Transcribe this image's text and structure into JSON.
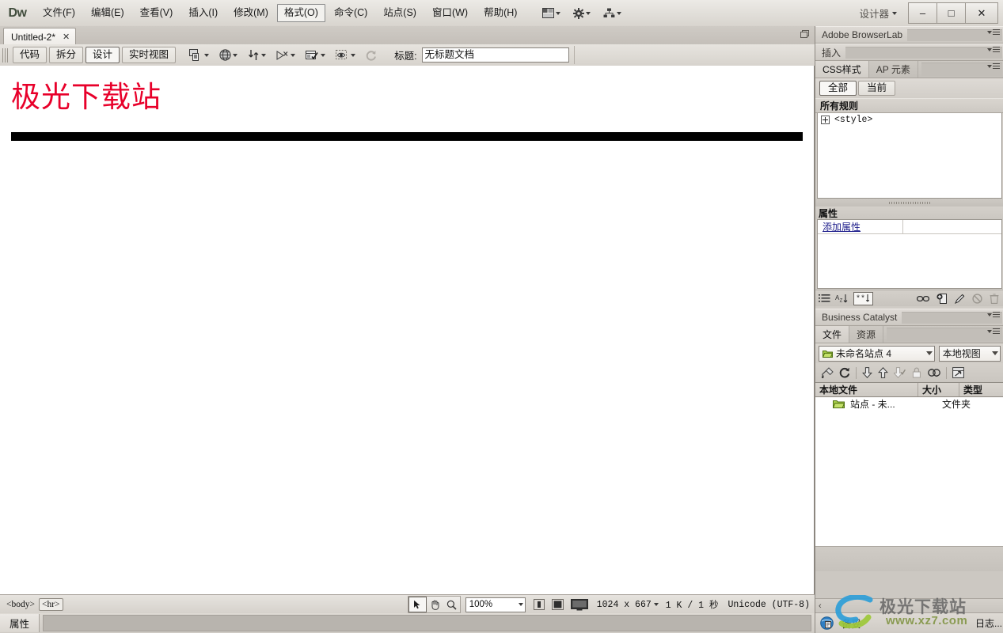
{
  "app": {
    "logo": "Dw",
    "workspace_label": "设计器"
  },
  "menubar": {
    "items": [
      {
        "label": "文件(F)",
        "active": false
      },
      {
        "label": "编辑(E)",
        "active": false
      },
      {
        "label": "查看(V)",
        "active": false
      },
      {
        "label": "插入(I)",
        "active": false
      },
      {
        "label": "修改(M)",
        "active": false
      },
      {
        "label": "格式(O)",
        "active": true
      },
      {
        "label": "命令(C)",
        "active": false
      },
      {
        "label": "站点(S)",
        "active": false
      },
      {
        "label": "窗口(W)",
        "active": false
      },
      {
        "label": "帮助(H)",
        "active": false
      }
    ],
    "quick_icons": [
      "layout-icon",
      "gear-icon",
      "site-icon"
    ]
  },
  "window_controls": {
    "minimize": "–",
    "maximize": "□",
    "close": "✕"
  },
  "document_tab": {
    "title": "Untitled-2*",
    "close": "✕"
  },
  "doc_toolbar": {
    "view_buttons": [
      {
        "label": "代码",
        "selected": false
      },
      {
        "label": "拆分",
        "selected": false
      },
      {
        "label": "设计",
        "selected": true
      },
      {
        "label": "实时视图",
        "selected": false
      }
    ],
    "icons": [
      "multiscreen-preview-icon",
      "preview-in-browser-icon",
      "file-management-icon",
      "validate-markup-icon",
      "visual-aids-icon",
      "live-code-inspect-icon",
      "refresh-icon"
    ],
    "title_label": "标题:",
    "title_value": "无标题文档",
    "title_placeholder": "无标题文档"
  },
  "canvas": {
    "heading": "极光下载站",
    "heading_color": "#e8002a",
    "hr": "horizontal-rule"
  },
  "status_bar": {
    "tag_selector": [
      {
        "tag": "<body>",
        "selected": false
      },
      {
        "tag": "<hr>",
        "selected": true
      }
    ],
    "tools": [
      {
        "name": "select-tool",
        "selected": true
      },
      {
        "name": "hand-tool",
        "selected": false
      },
      {
        "name": "zoom-tool",
        "selected": false
      }
    ],
    "zoom_value": "100%",
    "window_sizes": [
      "phone-size-icon",
      "tablet-size-icon",
      "desktop-size-icon"
    ],
    "dimensions": "1024 x 667",
    "download_info": "1 K / 1 秒",
    "encoding": "Unicode (UTF-8)"
  },
  "properties_bar": {
    "tab_label": "属性"
  },
  "dock": {
    "browserlab": {
      "title": "Adobe BrowserLab"
    },
    "insert": {
      "title": "插入"
    },
    "css_panel": {
      "tabs": [
        {
          "label": "CSS样式",
          "selected": true
        },
        {
          "label": "AP 元素",
          "selected": false
        }
      ],
      "mode_buttons": [
        {
          "label": "全部",
          "selected": true
        },
        {
          "label": "当前",
          "selected": false
        }
      ],
      "rules_header": "所有规则",
      "rules": [
        {
          "name": "<style>",
          "expandable": true
        }
      ],
      "properties_header": "属性",
      "property_rows": [
        {
          "name": "添加属性",
          "value": ""
        }
      ],
      "footer_icons_left": [
        {
          "name": "category-view-icon",
          "selected": false
        },
        {
          "name": "list-view-icon",
          "selected": false
        },
        {
          "name": "set-properties-icon",
          "selected": true
        }
      ],
      "footer_icons_right": [
        "attach-stylesheet-icon",
        "new-css-rule-icon",
        "edit-rule-icon",
        "disable-property-icon",
        "delete-property-icon"
      ]
    },
    "business_catalyst": {
      "title": "Business Catalyst"
    },
    "files_panel": {
      "tabs": [
        {
          "label": "文件",
          "selected": true
        },
        {
          "label": "资源",
          "selected": false
        }
      ],
      "site_select": "未命名站点 4",
      "view_select": "本地视图",
      "toolbar_icons": [
        "connect-remote-host-icon",
        "refresh-icon",
        "get-files-icon",
        "put-files-icon",
        "check-out-icon",
        "check-in-icon",
        "synchronize-icon",
        "expand-collapse-icon"
      ],
      "columns": [
        "本地文件",
        "大小",
        "类型"
      ],
      "rows": [
        {
          "name": "站点 - 未...",
          "size": "",
          "type": "文件夹",
          "icon": "folder-icon"
        }
      ]
    },
    "footer": {
      "left_arrow": "‹",
      "right_arrow": "›",
      "status_label": "备妥",
      "log_label": "日志..."
    }
  },
  "watermark": {
    "text": "极光下载站",
    "url": "www.xz7.com"
  }
}
